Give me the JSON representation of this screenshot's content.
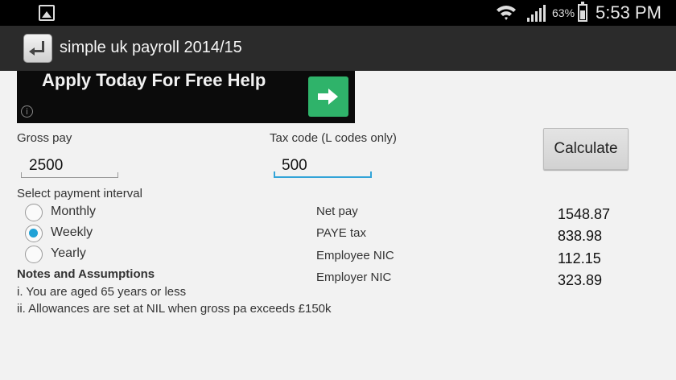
{
  "status_bar": {
    "battery_percent": "63%",
    "time": "5:53 PM"
  },
  "app": {
    "title": "simple uk payroll 2014/15"
  },
  "ad": {
    "text": "Apply Today For Free Help",
    "info_glyph": "i"
  },
  "form": {
    "gross_pay_label": "Gross pay",
    "gross_pay_value": "2500",
    "tax_code_label": "Tax code (L codes only)",
    "tax_code_value": "500",
    "calculate_label": "Calculate",
    "interval_label": "Select payment interval",
    "intervals": [
      {
        "label": "Monthly",
        "checked": false
      },
      {
        "label": "Weekly",
        "checked": true
      },
      {
        "label": "Yearly",
        "checked": false
      }
    ]
  },
  "results": [
    {
      "label": "Net pay",
      "value": "1548.87"
    },
    {
      "label": "PAYE tax",
      "value": "838.98"
    },
    {
      "label": "Employee NIC",
      "value": "112.15"
    },
    {
      "label": "Employer NIC",
      "value": "323.89"
    }
  ],
  "notes": {
    "title": "Notes and Assumptions",
    "items": [
      "i. You are aged 65 years or less",
      "ii. Allowances are set at NIL when gross pa exceeds £150k"
    ]
  }
}
